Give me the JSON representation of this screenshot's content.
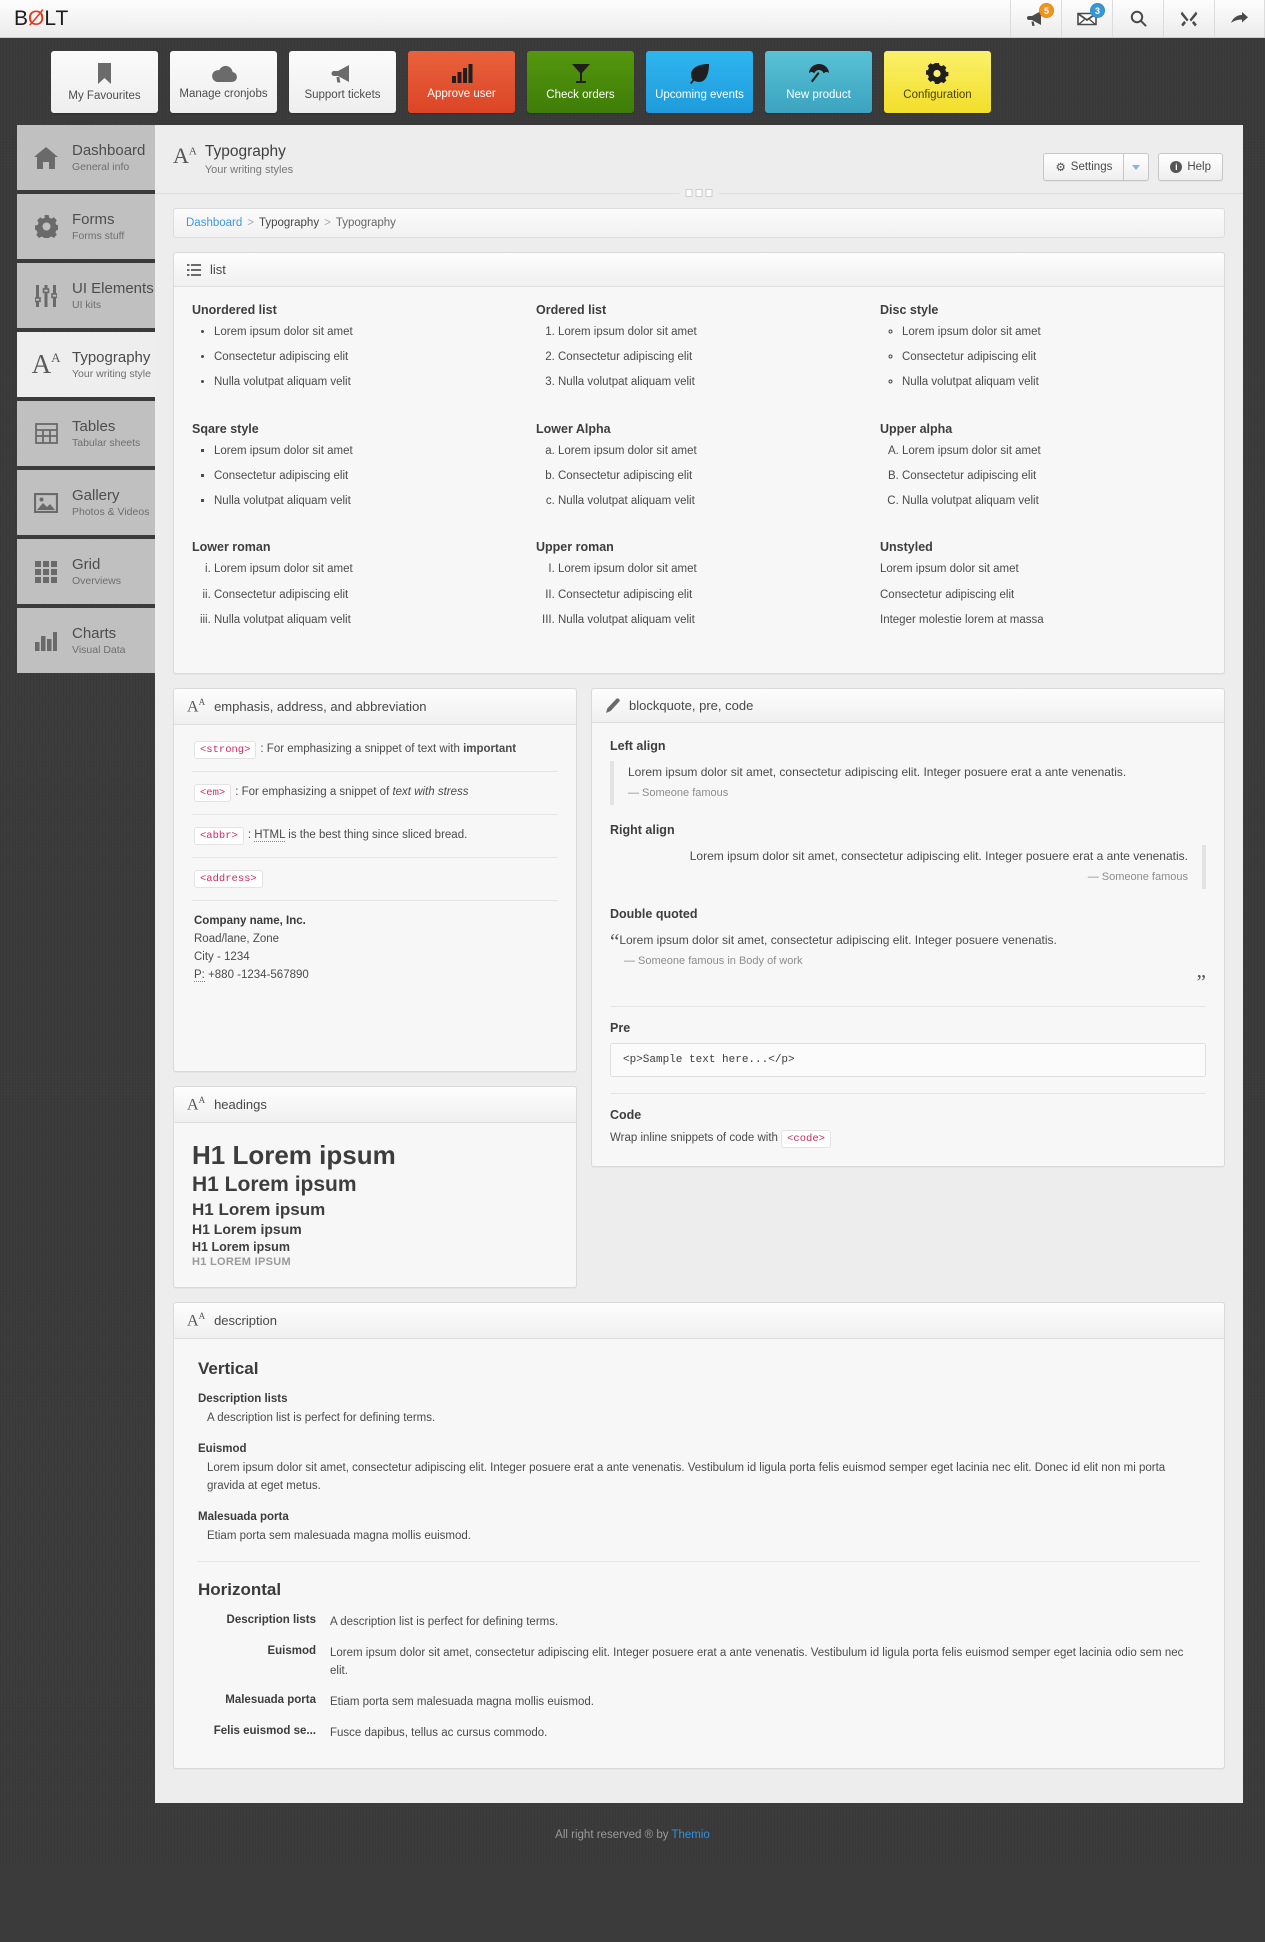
{
  "brand": {
    "pre": "B",
    "slash": "Ø",
    "post": "LT"
  },
  "topbar_icons": [
    {
      "name": "megaphone-icon",
      "badge": "5",
      "badge_color": "#f0941e"
    },
    {
      "name": "envelope-icon",
      "badge": "3",
      "badge_color": "#3498d8"
    },
    {
      "name": "search-icon",
      "badge": "",
      "badge_color": ""
    },
    {
      "name": "tools-icon",
      "badge": "",
      "badge_color": ""
    },
    {
      "name": "share-arrow-icon",
      "badge": "",
      "badge_color": ""
    }
  ],
  "tiles": [
    {
      "label": "My Favourites",
      "icon": "bookmark-icon",
      "color": ""
    },
    {
      "label": "Manage cronjobs",
      "icon": "cloud-icon",
      "color": ""
    },
    {
      "label": "Support tickets",
      "icon": "megaphone-icon",
      "color": ""
    },
    {
      "label": "Approve user",
      "icon": "bar-chart-icon",
      "color": "#e15432"
    },
    {
      "label": "Check orders",
      "icon": "cocktail-icon",
      "color": "#4b8f12"
    },
    {
      "label": "Upcoming events",
      "icon": "leaf-icon",
      "color": "#27a7e7"
    },
    {
      "label": "New product",
      "icon": "umbrella-icon",
      "color": "#45b3cc"
    },
    {
      "label": "Configuration",
      "icon": "gears-icon",
      "color": "#f7e33f"
    }
  ],
  "sidebar": [
    {
      "title": "Dashboard",
      "sub": "General info",
      "icon": "home-icon",
      "active": false
    },
    {
      "title": "Forms",
      "sub": "Forms stuff",
      "icon": "gear-icon",
      "active": false
    },
    {
      "title": "UI Elements",
      "sub": "UI kits",
      "icon": "sliders-icon",
      "active": false
    },
    {
      "title": "Typography",
      "sub": "Your writing style",
      "icon": "typography-icon",
      "active": true
    },
    {
      "title": "Tables",
      "sub": "Tabular sheets",
      "icon": "table-icon",
      "active": false
    },
    {
      "title": "Gallery",
      "sub": "Photos & Videos",
      "icon": "image-icon",
      "active": false
    },
    {
      "title": "Grid",
      "sub": "Overviews",
      "icon": "grid-icon",
      "active": false
    },
    {
      "title": "Charts",
      "sub": "Visual Data",
      "icon": "chart-icon",
      "active": false
    }
  ],
  "page": {
    "title": "Typography",
    "subtitle": "Your writing styles",
    "settings_label": "Settings",
    "help_label": "Help"
  },
  "breadcrumb": {
    "root": "Dashboard",
    "mid": "Typography",
    "current": "Typography"
  },
  "panels": {
    "list": "list",
    "emphasis": "emphasis, address, and abbreviation",
    "blockquote": "blockquote, pre, code",
    "headings": "headings",
    "description": "description"
  },
  "lists": [
    {
      "title": "Unordered list",
      "style": "ls-disc",
      "tag": "ul",
      "items": [
        "Lorem ipsum dolor sit amet",
        "Consectetur adipiscing elit",
        "Nulla volutpat aliquam velit"
      ]
    },
    {
      "title": "Ordered list",
      "style": "ls-decimal",
      "tag": "ol",
      "items": [
        "Lorem ipsum dolor sit amet",
        "Consectetur adipiscing elit",
        "Nulla volutpat aliquam velit"
      ]
    },
    {
      "title": "Disc style",
      "style": "ls-circle",
      "tag": "ul",
      "items": [
        "Lorem ipsum dolor sit amet",
        "Consectetur adipiscing elit",
        "Nulla volutpat aliquam velit"
      ]
    },
    {
      "title": "Sqare style",
      "style": "ls-square",
      "tag": "ul",
      "items": [
        "Lorem ipsum dolor sit amet",
        "Consectetur adipiscing elit",
        "Nulla volutpat aliquam velit"
      ]
    },
    {
      "title": "Lower Alpha",
      "style": "ls-lalpha",
      "tag": "ol",
      "items": [
        "Lorem ipsum dolor sit amet",
        "Consectetur adipiscing elit",
        "Nulla volutpat aliquam velit"
      ]
    },
    {
      "title": "Upper alpha",
      "style": "ls-ualpha",
      "tag": "ol",
      "items": [
        "Lorem ipsum dolor sit amet",
        "Consectetur adipiscing elit",
        "Nulla volutpat aliquam velit"
      ]
    },
    {
      "title": "Lower roman",
      "style": "ls-lroman",
      "tag": "ol",
      "items": [
        "Lorem ipsum dolor sit amet",
        "Consectetur adipiscing elit",
        "Nulla volutpat aliquam velit"
      ]
    },
    {
      "title": "Upper roman",
      "style": "ls-uroman",
      "tag": "ol",
      "items": [
        "Lorem ipsum dolor sit amet",
        "Consectetur adipiscing elit",
        "Nulla volutpat aliquam velit"
      ]
    },
    {
      "title": "Unstyled",
      "style": "ls-none",
      "tag": "ul",
      "items": [
        "Lorem ipsum dolor sit amet",
        "Consectetur adipiscing elit",
        "Integer molestie lorem at massa"
      ]
    }
  ],
  "emphasis": {
    "strong": {
      "tag": "<strong>",
      "text_before": ": For emphasizing a snippet of text with ",
      "bold_text": "important"
    },
    "em": {
      "tag": "<em>",
      "text_before": ": For emphasizing a snippet of ",
      "italic_text": "text with stress"
    },
    "abbr": {
      "tag": "<abbr>",
      "text_before": ": ",
      "abbr_text": "HTML",
      "text_after": " is the best thing since sliced bread."
    },
    "address": {
      "tag": "<address>",
      "company": "Company name, Inc.",
      "line1": "Road/lane, Zone",
      "line2": "City - 1234",
      "phone_label": "P:",
      "phone": " +880 -1234-567890"
    }
  },
  "headings": [
    {
      "text": "H1 Lorem ipsum",
      "cls": "hd1"
    },
    {
      "text": "H1 Lorem ipsum",
      "cls": "hd2"
    },
    {
      "text": "H1 Lorem ipsum",
      "cls": "hd3"
    },
    {
      "text": "H1 Lorem ipsum",
      "cls": "hd4"
    },
    {
      "text": "H1 Lorem ipsum",
      "cls": "hd5"
    },
    {
      "text": "H1 LOREM IPSUM",
      "cls": "hd6"
    }
  ],
  "blockquote": {
    "left_label": "Left align",
    "left_text": "Lorem ipsum dolor sit amet, consectetur adipiscing elit. Integer posuere erat a ante venenatis.",
    "left_by": "— Someone famous",
    "right_label": "Right align",
    "right_text": "Lorem ipsum dolor sit amet, consectetur adipiscing elit. Integer posuere erat a ante venenatis.",
    "right_by": "— Someone famous",
    "double_label": "Double quoted",
    "double_text": "Lorem ipsum dolor sit amet, consectetur adipiscing elit. Integer posuere venenatis.",
    "double_by": "— Someone famous in Body of work",
    "pre_label": "Pre",
    "pre_text": "<p>Sample text here...</p>",
    "code_label": "Code",
    "code_text": "Wrap inline snippets of code with ",
    "code_tag": "<code>"
  },
  "description": {
    "vertical_title": "Vertical",
    "horizontal_title": "Horizontal",
    "items": [
      {
        "term": "Description lists",
        "def": "A description list is perfect for defining terms."
      },
      {
        "term": "Euismod",
        "def": "Lorem ipsum dolor sit amet, consectetur adipiscing elit. Integer posuere erat a ante venenatis. Vestibulum id ligula porta felis euismod semper eget lacinia nec elit. Donec id elit non mi porta gravida at eget metus."
      },
      {
        "term": "Malesuada porta",
        "def": "Etiam porta sem malesuada magna mollis euismod."
      }
    ],
    "horizontal_items": [
      {
        "term": "Description lists",
        "def": "A description list is perfect for defining terms."
      },
      {
        "term": "Euismod",
        "def": "Lorem ipsum dolor sit amet, consectetur adipiscing elit. Integer posuere erat a ante venenatis. Vestibulum id ligula porta felis euismod semper eget lacinia odio sem nec elit."
      },
      {
        "term": "Malesuada porta",
        "def": "Etiam porta sem malesuada magna mollis euismod."
      },
      {
        "term": "Felis euismod se...",
        "def": "Fusce dapibus, tellus ac cursus commodo."
      }
    ]
  },
  "footer": {
    "text": "All right reserved ® by ",
    "link": "Themio"
  }
}
